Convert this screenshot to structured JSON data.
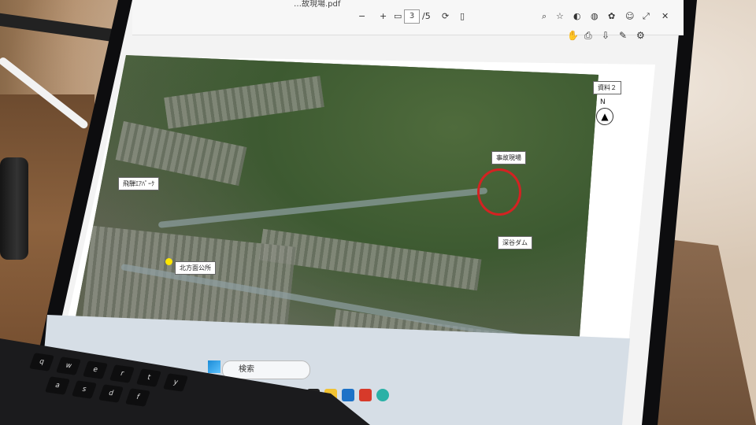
{
  "pdf_toolbar": {
    "file_title": "…故現場.pdf",
    "page_current": "3",
    "page_total": "/5",
    "zoom_minus": "−",
    "zoom_plus": "+"
  },
  "map": {
    "doc_label": "資料２",
    "north_letter": "N",
    "labels": {
      "accident_site": "事故現場",
      "dam": "深谷ダム",
      "left_road": "飛騨ｴｱﾊﾟｰｸ",
      "station": "北方面公所"
    }
  },
  "taskbar": {
    "search_placeholder": "検索"
  },
  "keys": [
    "q",
    "w",
    "e",
    "r",
    "t",
    "y",
    "a",
    "s",
    "d",
    "f"
  ]
}
